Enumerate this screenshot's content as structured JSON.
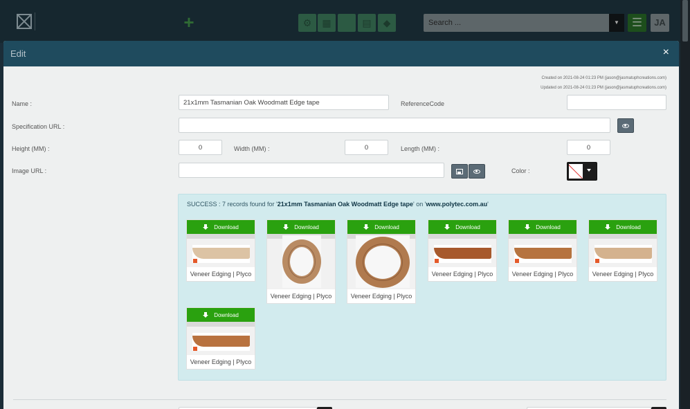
{
  "topbar": {
    "add_icon": "plus-icon",
    "tools": [
      "cogs-icon",
      "calculator-icon",
      "blank-icon",
      "clipboard-icon",
      "tags-icon"
    ],
    "search_placeholder": "Search ...",
    "avatar_initials": "JA"
  },
  "modal": {
    "title": "Edit",
    "close_label": "×",
    "created": "Created on 2021-08-24 01:23 PM (jason@jasmatuphcreations.com)",
    "updated": "Updated on 2021-08-24 01:23 PM (jason@jasmatuphcreations.com)"
  },
  "form": {
    "name_label": "Name :",
    "name_value": "21x1mm Tasmanian Oak Woodmatt Edge tape",
    "reference_label": "ReferenceCode",
    "reference_value": "",
    "spec_label": "Specification URL :",
    "spec_value": "",
    "height_label": "Height (MM) :",
    "height_value": "0",
    "width_label": "Width (MM) :",
    "width_value": "0",
    "length_label": "Length (MM) :",
    "length_value": "0",
    "image_label": "Image URL :",
    "image_value": "",
    "color_label": "Color :"
  },
  "results": {
    "prefix": "SUCCESS : 7 records found for '",
    "query": "21x1mm Tasmanian Oak Woodmatt Edge tape",
    "middle": "' on '",
    "site": "www.polytec.com.au",
    "suffix": "'",
    "download_label": "Download",
    "items": [
      {
        "label": "Veneer Edging | Plyco",
        "kind": "flat",
        "color": "#dcc3a4"
      },
      {
        "label": "Veneer Edging | Plyco",
        "kind": "round-small",
        "color": "#b98b63"
      },
      {
        "label": "Veneer Edging | Plyco",
        "kind": "round-big",
        "color": "#b07a4e"
      },
      {
        "label": "Veneer Edging | Plyco",
        "kind": "flat",
        "color": "#a7592c"
      },
      {
        "label": "Veneer Edging | Plyco",
        "kind": "flat",
        "color": "#b6733f"
      },
      {
        "label": "Veneer Edging | Plyco",
        "kind": "flat",
        "color": "#d4b28e"
      },
      {
        "label": "Veneer Edging | Plyco",
        "kind": "flat",
        "color": "#b8723f"
      }
    ]
  },
  "colors": {
    "header": "#1f4b5e",
    "download": "#2aa10f",
    "panel": "#d2ebee"
  }
}
